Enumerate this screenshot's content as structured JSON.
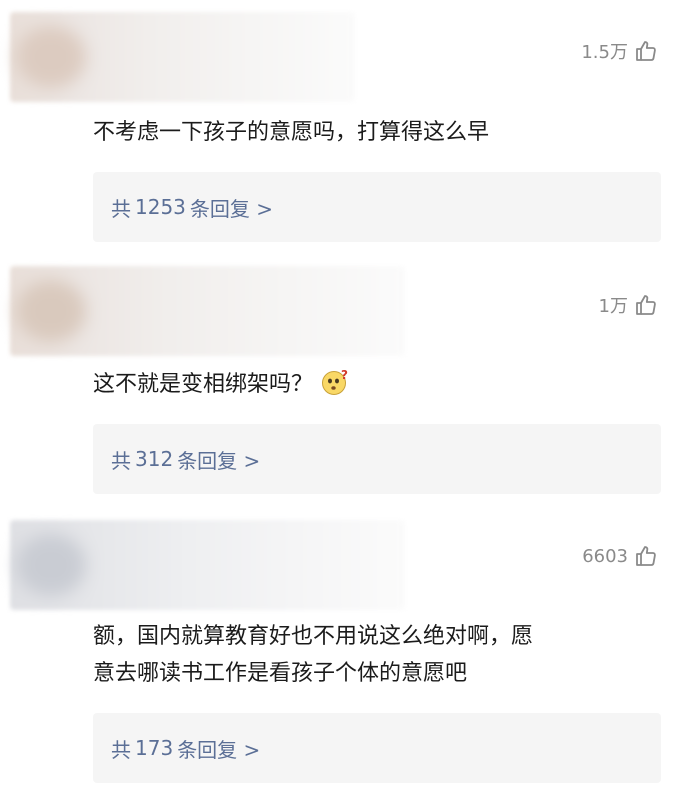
{
  "comments": [
    {
      "likes": "1.5万",
      "text": "不考虑一下孩子的意愿吗，打算得这么早",
      "reply": {
        "prefix": "共",
        "count": "1253",
        "suffix": "条回复 >"
      }
    },
    {
      "likes": "1万",
      "text": "这不就是变相绑架吗？",
      "emoji": "thinking-face-with-question",
      "reply": {
        "prefix": "共",
        "count": "312",
        "suffix": "条回复 >"
      }
    },
    {
      "likes": "6603",
      "text_lines": [
        "额，国内就算教育好也不用说这么绝对啊，愿",
        "意去哪读书工作是看孩子个体的意愿吧"
      ],
      "reply": {
        "prefix": "共",
        "count": "173",
        "suffix": "条回复 >"
      }
    }
  ],
  "colors": {
    "reply_text": "#5b6f96",
    "reply_bg": "#f5f5f5",
    "likes": "#8a8a8a"
  },
  "icons": {
    "like": "thumbs-up-outline-icon"
  }
}
